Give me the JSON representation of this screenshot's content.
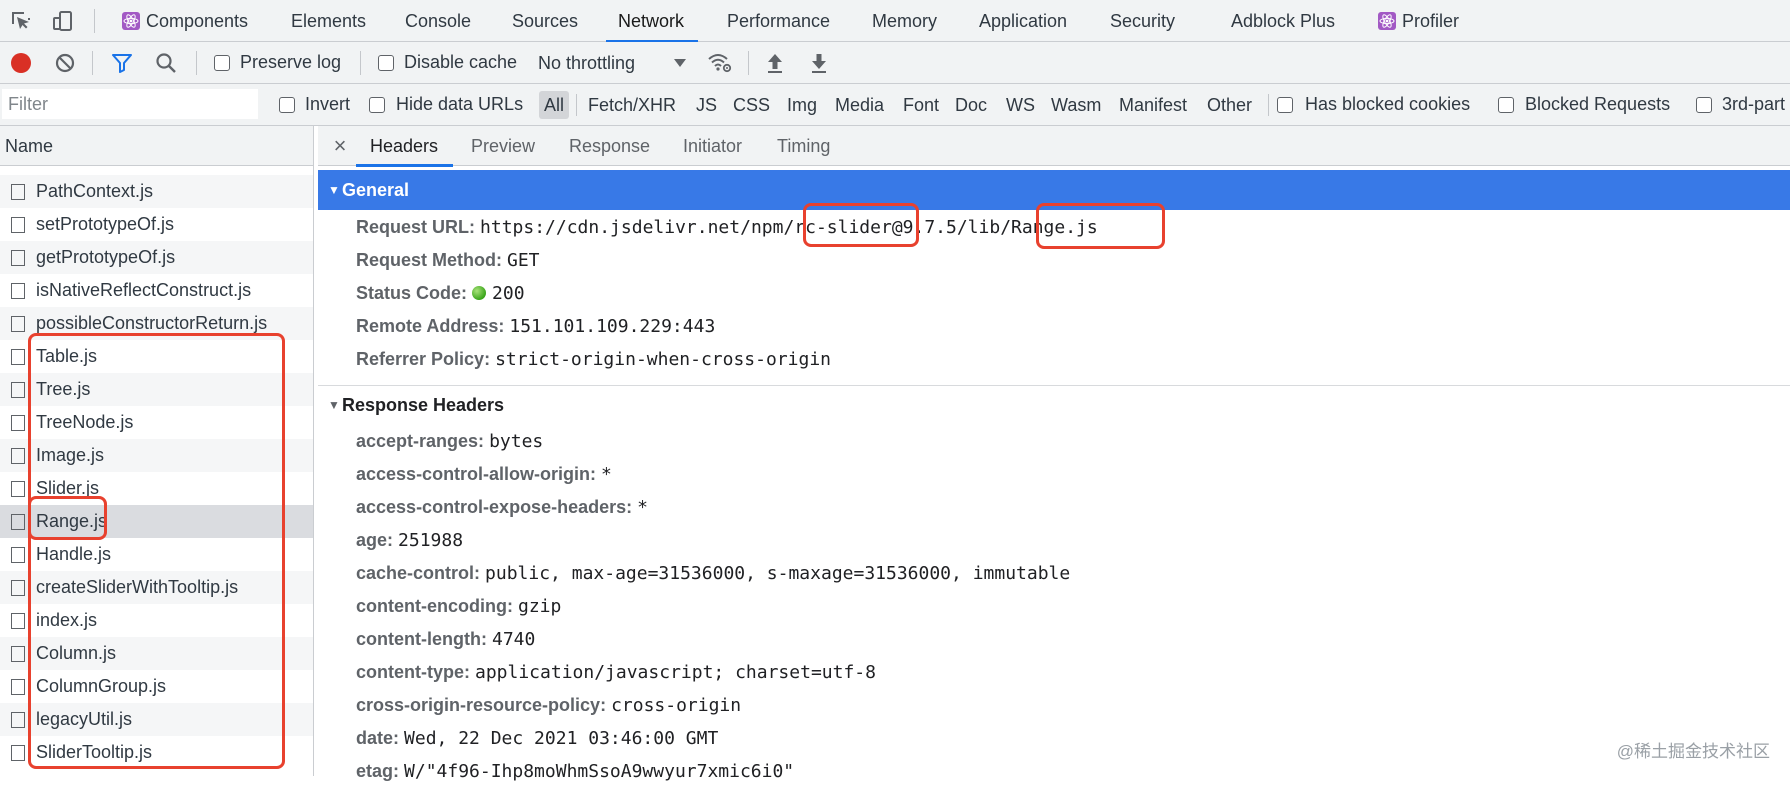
{
  "tabbar": {
    "tabs": [
      {
        "label": "Components",
        "icon": "react-icon",
        "active": false
      },
      {
        "label": "Elements",
        "active": false
      },
      {
        "label": "Console",
        "active": false
      },
      {
        "label": "Sources",
        "active": false
      },
      {
        "label": "Network",
        "active": true
      },
      {
        "label": "Performance",
        "active": false
      },
      {
        "label": "Memory",
        "active": false
      },
      {
        "label": "Application",
        "active": false
      },
      {
        "label": "Security",
        "active": false
      },
      {
        "label": "Adblock Plus",
        "active": false
      },
      {
        "label": "Profiler",
        "icon": "react-icon",
        "active": false
      }
    ]
  },
  "toolbar": {
    "preserve_log": "Preserve log",
    "disable_cache": "Disable cache",
    "throttling": "No throttling"
  },
  "filterbar": {
    "placeholder": "Filter",
    "invert": "Invert",
    "hide_data_urls": "Hide data URLs",
    "types": [
      "All",
      "Fetch/XHR",
      "JS",
      "CSS",
      "Img",
      "Media",
      "Font",
      "Doc",
      "WS",
      "Wasm",
      "Manifest",
      "Other"
    ],
    "active_type": "All",
    "has_blocked_cookies": "Has blocked cookies",
    "blocked_requests": "Blocked Requests",
    "third_party": "3rd-part"
  },
  "requests": {
    "header": "Name",
    "selected": "Range.js",
    "items": [
      "PathContext.js",
      "setPrototypeOf.js",
      "getPrototypeOf.js",
      "isNativeReflectConstruct.js",
      "possibleConstructorReturn.js",
      "Table.js",
      "Tree.js",
      "TreeNode.js",
      "Image.js",
      "Slider.js",
      "Range.js",
      "Handle.js",
      "createSliderWithTooltip.js",
      "index.js",
      "Column.js",
      "ColumnGroup.js",
      "legacyUtil.js",
      "SliderTooltip.js"
    ]
  },
  "detail": {
    "tabs": [
      "Headers",
      "Preview",
      "Response",
      "Initiator",
      "Timing"
    ],
    "active_tab": "Headers",
    "general": {
      "title": "General",
      "rows": [
        {
          "key": "Request URL:",
          "value": "https://cdn.jsdelivr.net/npm/rc-slider@9.7.5/lib/Range.js"
        },
        {
          "key": "Request Method:",
          "value": "GET"
        },
        {
          "key": "Status Code:",
          "value": "200"
        },
        {
          "key": "Remote Address:",
          "value": "151.101.109.229:443"
        },
        {
          "key": "Referrer Policy:",
          "value": "strict-origin-when-cross-origin"
        }
      ]
    },
    "response_headers": {
      "title": "Response Headers",
      "rows": [
        {
          "key": "accept-ranges:",
          "value": "bytes"
        },
        {
          "key": "access-control-allow-origin:",
          "value": "*"
        },
        {
          "key": "access-control-expose-headers:",
          "value": "*"
        },
        {
          "key": "age:",
          "value": "251988"
        },
        {
          "key": "cache-control:",
          "value": "public, max-age=31536000, s-maxage=31536000, immutable"
        },
        {
          "key": "content-encoding:",
          "value": "gzip"
        },
        {
          "key": "content-length:",
          "value": "4740"
        },
        {
          "key": "content-type:",
          "value": "application/javascript; charset=utf-8"
        },
        {
          "key": "cross-origin-resource-policy:",
          "value": "cross-origin"
        },
        {
          "key": "date:",
          "value": "Wed, 22 Dec 2021 03:46:00 GMT"
        },
        {
          "key": "etag:",
          "value": "W/\"4f96-Ihp8moWhmSsoA9wwyur7xmic6i0\""
        }
      ]
    }
  },
  "watermark": "@稀土掘金技术社区",
  "colors": {
    "accent": "#1a73e8",
    "general_header": "#3879e7",
    "annotation": "#e8412e",
    "record": "#d93025"
  }
}
